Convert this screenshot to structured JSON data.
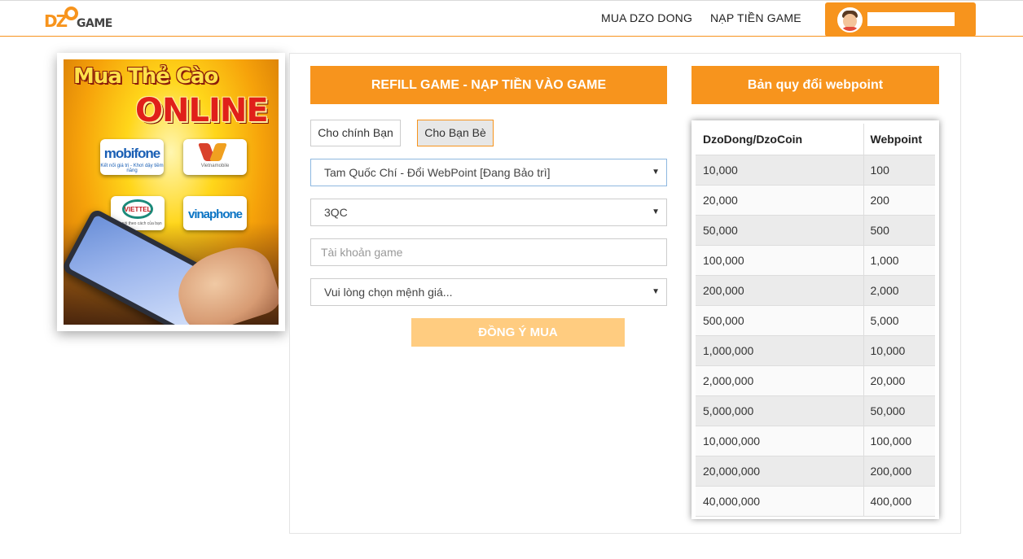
{
  "header": {
    "logo_text": "DZO",
    "logo_game": "GAME",
    "nav": {
      "buy_dzo_dong": "MUA DZO DONG",
      "refill_game": "NẠP TIỀN GAME"
    }
  },
  "banner": {
    "title_line1": "Mua Thẻ Cào",
    "title_line2": "ONLINE",
    "carriers": {
      "mobifone": "mobifone",
      "mobifone_sub": "Kết nối giá trị - Khơi dậy tiềm năng",
      "vietnamobile": "Vietnamobile",
      "viettel": "VIETTEL",
      "viettel_sub": "Hãy nói theo cách của bạn",
      "vinaphone": "vinaphone"
    }
  },
  "refill": {
    "header": "REFILL GAME - NẠP TIỀN VÀO GAME",
    "toggle_self": "Cho chính Bạn",
    "toggle_friend": "Cho Bạn Bè",
    "game_select": "Tam Quốc Chí - Đổi WebPoint [Đang Bảo trì]",
    "server_select": "3QC",
    "account_placeholder": "Tài khoản game",
    "value_select": "Vui lòng chọn mệnh giá...",
    "submit": "ĐỒNG Ý MUA"
  },
  "conversion": {
    "header": "Bản quy đổi webpoint",
    "columns": [
      "DzoDong/DzoCoin",
      "Webpoint"
    ],
    "rows": [
      [
        "10,000",
        "100"
      ],
      [
        "20,000",
        "200"
      ],
      [
        "50,000",
        "500"
      ],
      [
        "100,000",
        "1,000"
      ],
      [
        "200,000",
        "2,000"
      ],
      [
        "500,000",
        "5,000"
      ],
      [
        "1,000,000",
        "10,000"
      ],
      [
        "2,000,000",
        "20,000"
      ],
      [
        "5,000,000",
        "50,000"
      ],
      [
        "10,000,000",
        "100,000"
      ],
      [
        "20,000,000",
        "200,000"
      ],
      [
        "40,000,000",
        "400,000"
      ]
    ]
  },
  "colors": {
    "accent": "#f7941d",
    "submit_disabled": "#ffcc80"
  },
  "icons": {
    "dropdown": "chevron-down-icon",
    "avatar": "user-avatar-icon"
  }
}
